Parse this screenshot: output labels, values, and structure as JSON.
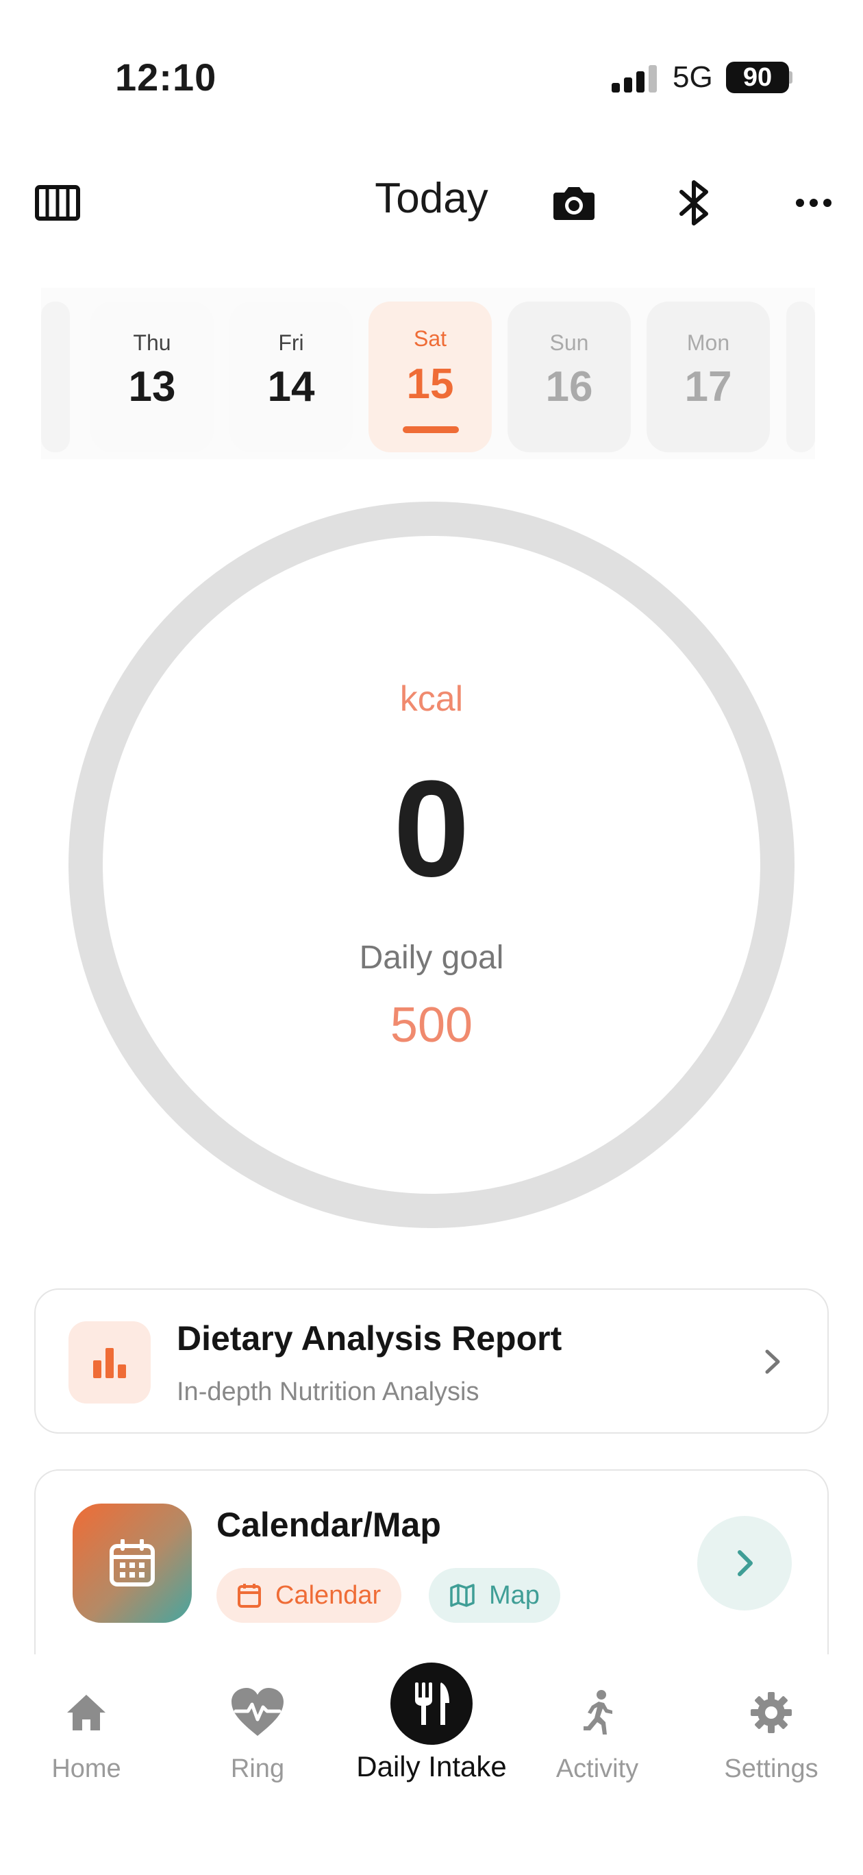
{
  "status_bar": {
    "time": "12:10",
    "network": "5G",
    "battery": "90"
  },
  "header": {
    "title": "Today"
  },
  "dates": [
    {
      "dow": "Thu",
      "day": "13",
      "state": "past"
    },
    {
      "dow": "Fri",
      "day": "14",
      "state": "past"
    },
    {
      "dow": "Sat",
      "day": "15",
      "state": "selected"
    },
    {
      "dow": "Sun",
      "day": "16",
      "state": "future"
    },
    {
      "dow": "Mon",
      "day": "17",
      "state": "future"
    }
  ],
  "intake": {
    "unit": "kcal",
    "value": "0",
    "goal_label": "Daily goal",
    "goal_value": "500",
    "progress": 0
  },
  "report_card": {
    "title": "Dietary Analysis Report",
    "subtitle": "In-depth Nutrition Analysis",
    "icon": "bar-chart-icon"
  },
  "calendar_card": {
    "title": "Calendar/Map",
    "chip_calendar": "Calendar",
    "chip_map": "Map",
    "icon": "calendar-icon"
  },
  "tabs": {
    "home": "Home",
    "ring": "Ring",
    "daily_intake": "Daily Intake",
    "activity": "Activity",
    "settings": "Settings"
  },
  "colors": {
    "accent": "#ef6c36",
    "accent_soft": "#f08a6e",
    "teal": "#3f9e96",
    "ring_track": "#e0e0e0"
  }
}
